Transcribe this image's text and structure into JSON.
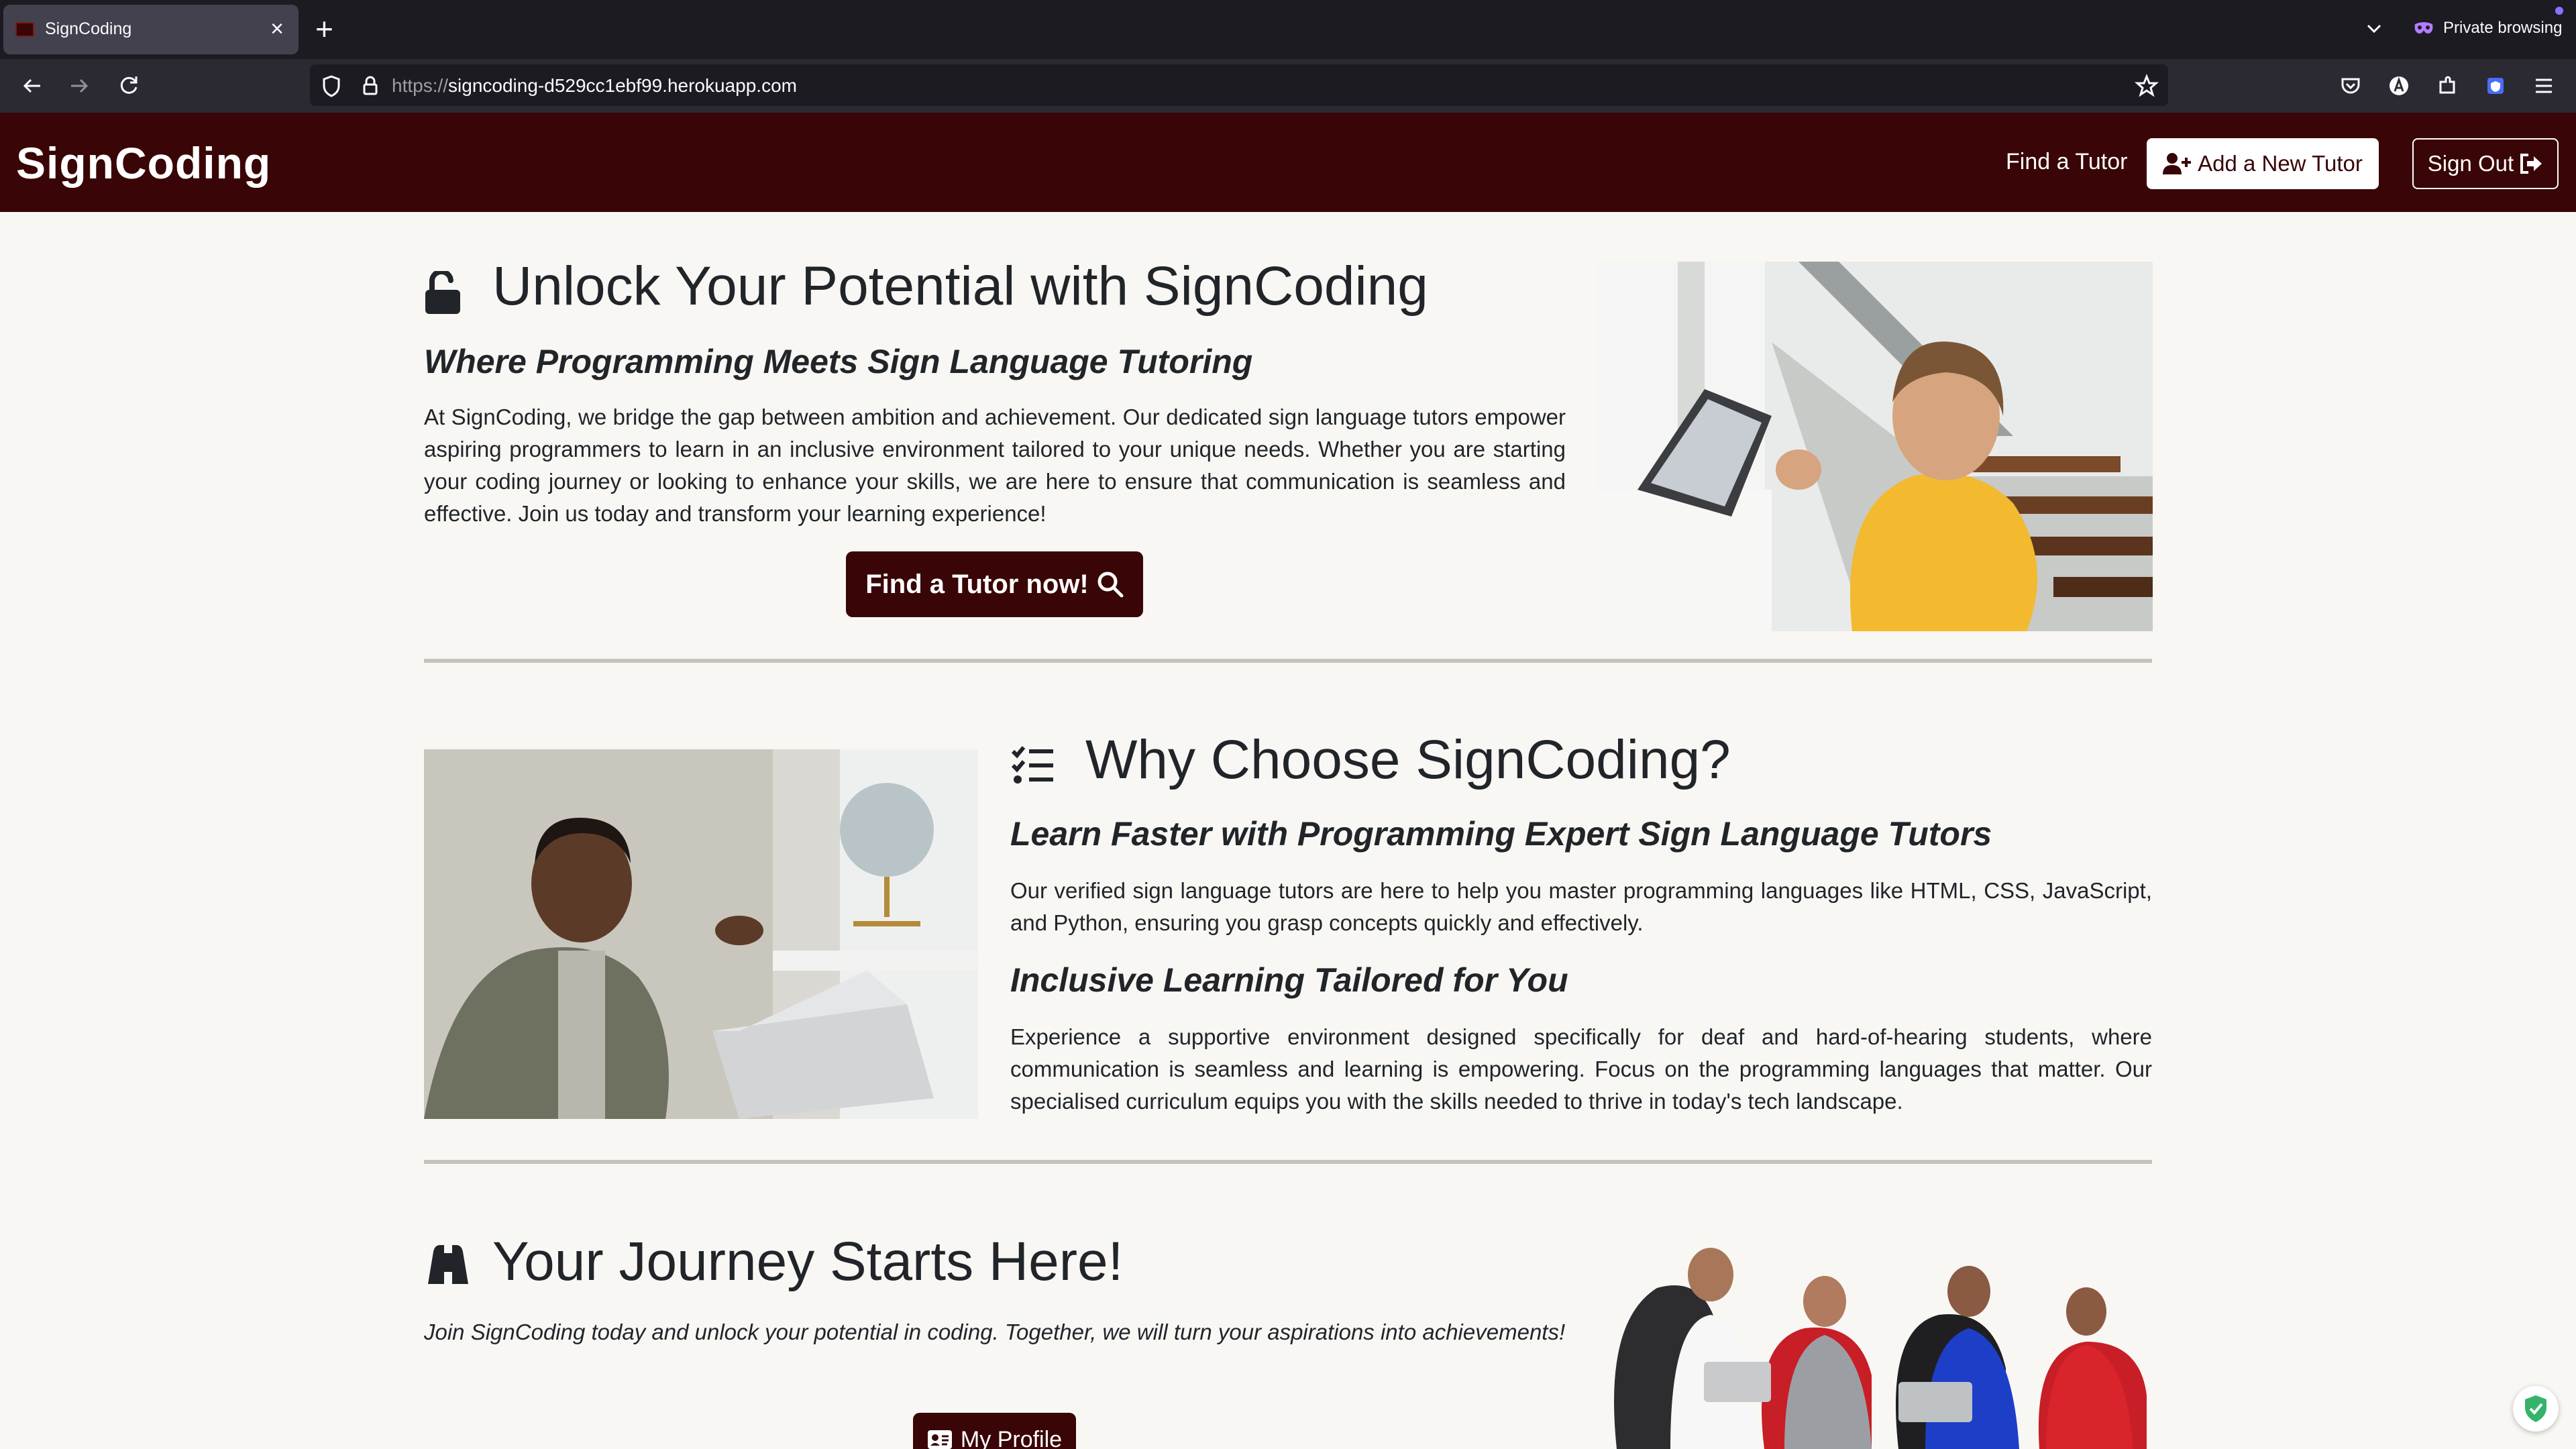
{
  "browser": {
    "tab_title": "SignCoding",
    "url_scheme": "https://",
    "url_host": "signcoding-d529cc1ebf99.herokuapp.com",
    "private_label": "Private browsing"
  },
  "header": {
    "brand": "SignCoding",
    "find_tutor_link": "Find a Tutor",
    "add_tutor_button": "Add a New Tutor",
    "sign_out_button": "Sign Out"
  },
  "hero": {
    "title": "Unlock Your Potential with SignCoding",
    "subtitle": "Where Programming Meets Sign Language Tutoring",
    "body": "At SignCoding, we bridge the gap between ambition and achievement. Our dedicated sign language tutors empower aspiring programmers to learn in an inclusive environment tailored to your unique needs. Whether you are starting your coding journey or looking to enhance your skills, we are here to ensure that communication is seamless and effective. Join us today and transform your learning experience!",
    "cta": "Find a Tutor now!"
  },
  "why": {
    "title": "Why Choose SignCoding?",
    "sub1": "Learn Faster with Programming Expert Sign Language Tutors",
    "body1": "Our verified sign language tutors are here to help you master programming languages like HTML, CSS, JavaScript, and Python, ensuring you grasp concepts quickly and effectively.",
    "sub2": "Inclusive Learning Tailored for You",
    "body2": "Experience a supportive environment designed specifically for deaf and hard-of-hearing students, where communication is seamless and learning is empowering. Focus on the programming languages that matter. Our specialised curriculum equips you with the skills needed to thrive in today's tech landscape."
  },
  "journey": {
    "title": "Your Journey Starts Here!",
    "body": "Join SignCoding today and unlock your potential in coding. Together, we will turn your aspirations into achievements!",
    "cta": "My Profile"
  },
  "icons": {
    "hero": "unlock-icon",
    "why": "list-check-icon",
    "journey": "binoculars-icon",
    "cta_search": "search-icon",
    "add_tutor": "user-plus-icon",
    "sign_out": "sign-out-icon",
    "profile": "id-card-icon"
  },
  "colors": {
    "brand_dark": "#3a0506",
    "page_bg": "#f8f7f4",
    "divider": "#c9c1bb"
  }
}
